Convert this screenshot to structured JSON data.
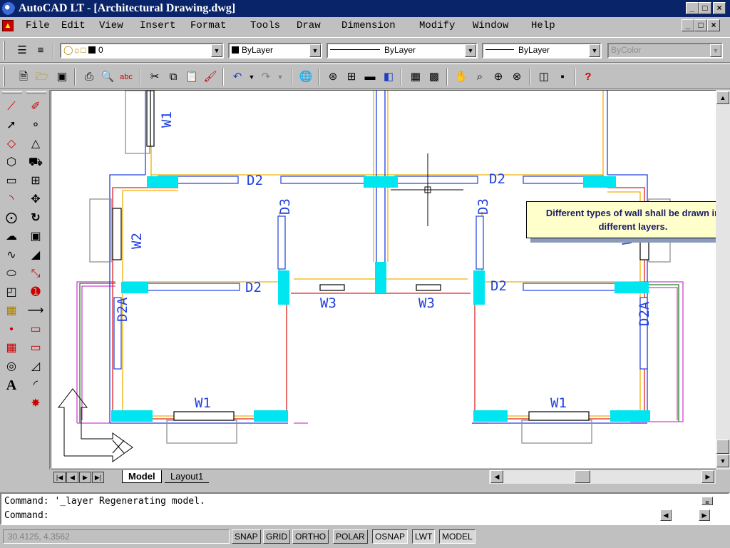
{
  "window": {
    "title": "AutoCAD LT - [Architectural Drawing.dwg]",
    "min": "_",
    "max": "□",
    "close": "×"
  },
  "menu": [
    "File",
    "Edit",
    "View",
    "Insert",
    "Format",
    "Tools",
    "Draw",
    "Dimension",
    "Modify",
    "Window",
    "Help"
  ],
  "layer_toolbar": {
    "layer": "0",
    "color": "ByLayer",
    "linetype": "ByLayer",
    "lineweight": "ByLayer",
    "plotstyle": "ByColor"
  },
  "drawing": {
    "callout": "Different types of wall shall be drawn in different layers.",
    "labels": {
      "w1": "W1",
      "w2": "W2",
      "w3": "W3",
      "d2": "D2",
      "d3": "D3",
      "d2a": "D2A"
    }
  },
  "tabs": {
    "model": "Model",
    "layout": "Layout1"
  },
  "command": {
    "line1": "Command: '_layer Regenerating model.",
    "line2": "Command:"
  },
  "status": {
    "coords": "30.4125, 4.3562",
    "buttons": [
      "SNAP",
      "GRID",
      "ORTHO",
      "POLAR",
      "OSNAP",
      "LWT",
      "MODEL"
    ]
  },
  "icons": [
    "autocad-app-icon",
    "new-icon",
    "open-icon",
    "save-icon",
    "print-icon",
    "preview-icon",
    "spell-icon",
    "cut-icon",
    "copy-icon",
    "paste-icon",
    "matchprop-icon",
    "undo-icon",
    "redo-icon",
    "help-icon"
  ],
  "colors": {
    "title_bar": "#0a246a",
    "wall_red": "#e02020",
    "wall_yellow": "#f0b000",
    "wall_blue": "#2040e0",
    "door_cyan": "#00e6f0",
    "outer_magenta": "#d040d0",
    "outer_green": "#208020"
  }
}
